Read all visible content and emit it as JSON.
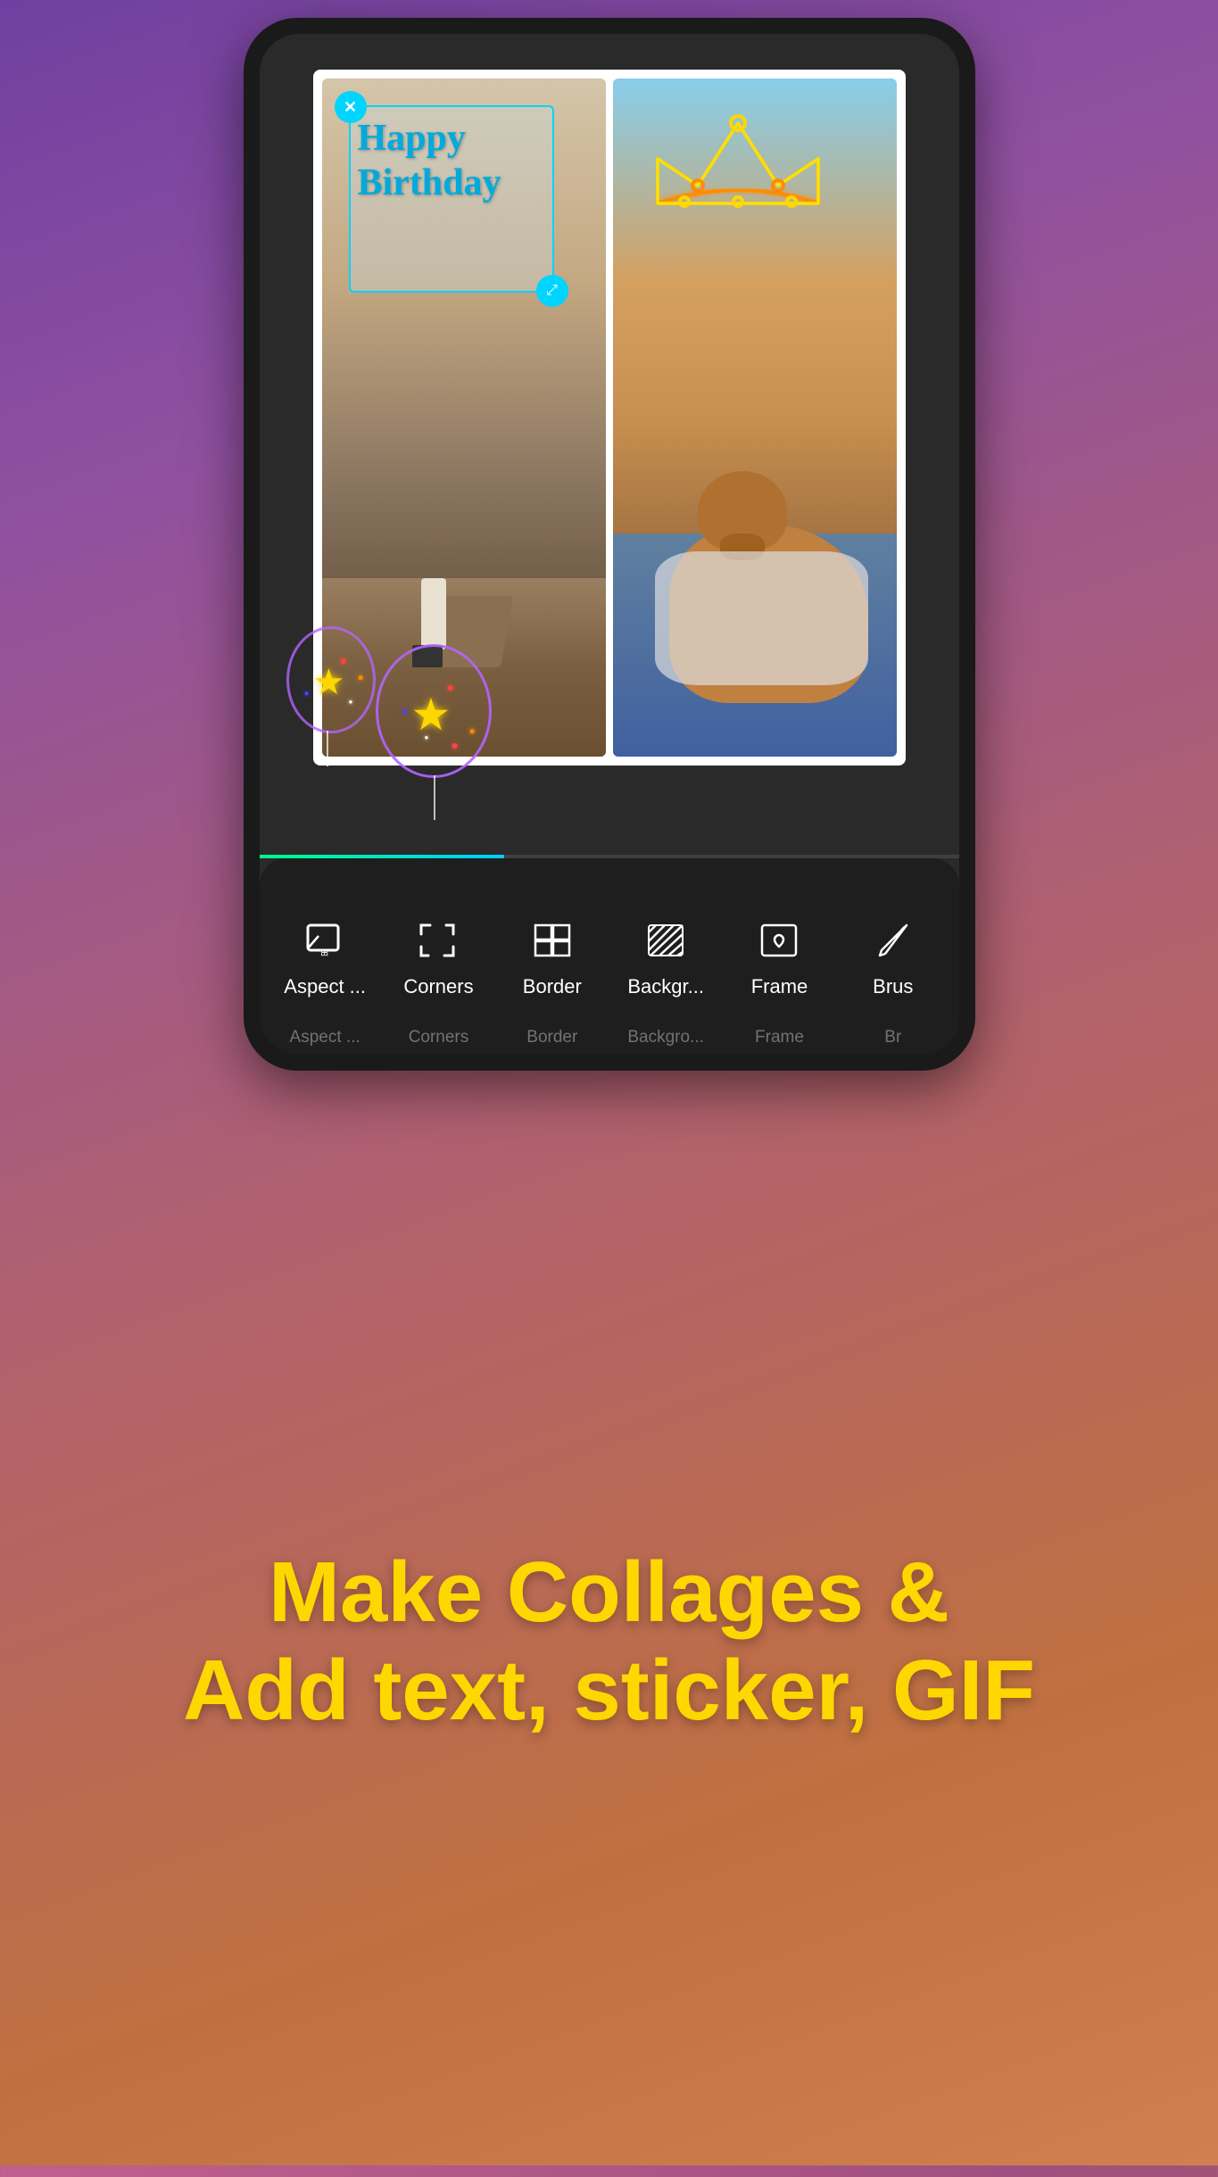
{
  "background": {
    "gradient_start": "#7040a0",
    "gradient_end": "#d08050"
  },
  "phone": {
    "collage": {
      "birthday_text_line1": "Happy",
      "birthday_text_line2": "Birthday"
    },
    "toolbar": {
      "items": [
        {
          "id": "aspect",
          "label": "Aspect ...",
          "shadow_label": "Aspect ..."
        },
        {
          "id": "corners",
          "label": "Corners",
          "shadow_label": "Corners"
        },
        {
          "id": "border",
          "label": "Border",
          "shadow_label": "Border"
        },
        {
          "id": "background",
          "label": "Backgr...",
          "shadow_label": "Backgro..."
        },
        {
          "id": "frame",
          "label": "Frame",
          "shadow_label": "Frame"
        },
        {
          "id": "brush",
          "label": "Brus",
          "shadow_label": "Br"
        }
      ]
    }
  },
  "bottom_section": {
    "tagline_line1": "Make Collages &",
    "tagline_line2": "Add text, sticker, GIF"
  }
}
